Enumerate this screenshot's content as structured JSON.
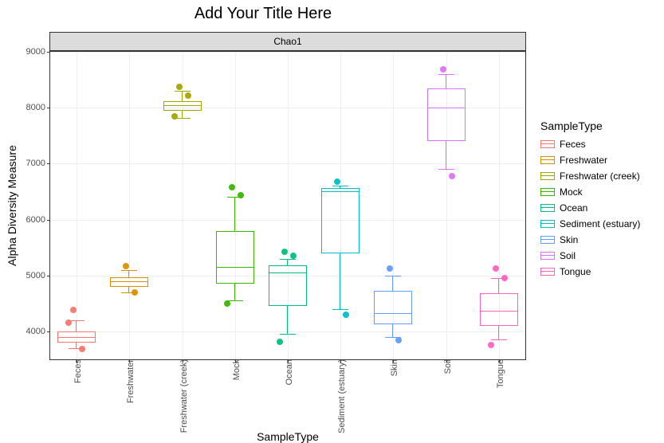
{
  "title": "Add Your Title Here",
  "facet_label": "Chao1",
  "ylabel": "Alpha Diversity Measure",
  "xlabel": "SampleType",
  "legend_title": "SampleType",
  "yticks": [
    4000,
    5000,
    6000,
    7000,
    8000,
    9000
  ],
  "ylim": [
    3500,
    9000
  ],
  "categories": [
    {
      "key": "feces",
      "label": "Feces",
      "color": "#F8766D"
    },
    {
      "key": "fresh",
      "label": "Freshwater",
      "color": "#D89000"
    },
    {
      "key": "creek",
      "label": "Freshwater (creek)",
      "color": "#A3A500"
    },
    {
      "key": "mock",
      "label": "Mock",
      "color": "#39B600"
    },
    {
      "key": "ocean",
      "label": "Ocean",
      "color": "#00BF7D"
    },
    {
      "key": "sediment",
      "label": "Sediment (estuary)",
      "color": "#00BFC4"
    },
    {
      "key": "skin",
      "label": "Skin",
      "color": "#619CFF"
    },
    {
      "key": "soil",
      "label": "Soil",
      "color": "#DB72FB"
    },
    {
      "key": "tongue",
      "label": "Tongue",
      "color": "#FF61C3"
    }
  ],
  "chart_data": {
    "type": "box",
    "title": "Add Your Title Here",
    "facet": "Chao1",
    "xlabel": "SampleType",
    "ylabel": "Alpha Diversity Measure",
    "ylim": [
      3500,
      9000
    ],
    "yticks": [
      4000,
      5000,
      6000,
      7000,
      8000,
      9000
    ],
    "legend_title": "SampleType",
    "series": [
      {
        "name": "Feces",
        "color": "#F8766D",
        "lower_whisker": 3700,
        "q1": 3800,
        "median": 3900,
        "q3": 4000,
        "upper_whisker": 4200,
        "outliers": [
          4380,
          3680,
          4150
        ]
      },
      {
        "name": "Freshwater",
        "color": "#D89000",
        "lower_whisker": 4700,
        "q1": 4800,
        "median": 4900,
        "q3": 4970,
        "upper_whisker": 5100,
        "outliers": [
          5170,
          4700
        ]
      },
      {
        "name": "Freshwater (creek)",
        "color": "#A3A500",
        "lower_whisker": 7820,
        "q1": 7950,
        "median": 8050,
        "q3": 8120,
        "upper_whisker": 8300,
        "outliers": [
          8370,
          8220,
          7850
        ]
      },
      {
        "name": "Mock",
        "color": "#39B600",
        "lower_whisker": 4550,
        "q1": 4850,
        "median": 5150,
        "q3": 5800,
        "upper_whisker": 6400,
        "outliers": [
          6580,
          6430,
          4500
        ]
      },
      {
        "name": "Ocean",
        "color": "#00BF7D",
        "lower_whisker": 3950,
        "q1": 4450,
        "median": 5050,
        "q3": 5180,
        "upper_whisker": 5300,
        "outliers": [
          5420,
          5350,
          3820
        ]
      },
      {
        "name": "Sediment (estuary)",
        "color": "#00BFC4",
        "lower_whisker": 4400,
        "q1": 5400,
        "median": 6500,
        "q3": 6560,
        "upper_whisker": 6600,
        "outliers": [
          6680,
          4300
        ]
      },
      {
        "name": "Skin",
        "color": "#619CFF",
        "lower_whisker": 3900,
        "q1": 4120,
        "median": 4330,
        "q3": 4720,
        "upper_whisker": 5000,
        "outliers": [
          5120,
          3840
        ]
      },
      {
        "name": "Soil",
        "color": "#DB72FB",
        "lower_whisker": 6900,
        "q1": 7400,
        "median": 8000,
        "q3": 8350,
        "upper_whisker": 8600,
        "outliers": [
          8680,
          6780
        ]
      },
      {
        "name": "Tongue",
        "color": "#FF61C3",
        "lower_whisker": 3850,
        "q1": 4100,
        "median": 4370,
        "q3": 4680,
        "upper_whisker": 4950,
        "outliers": [
          5130,
          4960,
          3750
        ]
      }
    ]
  }
}
